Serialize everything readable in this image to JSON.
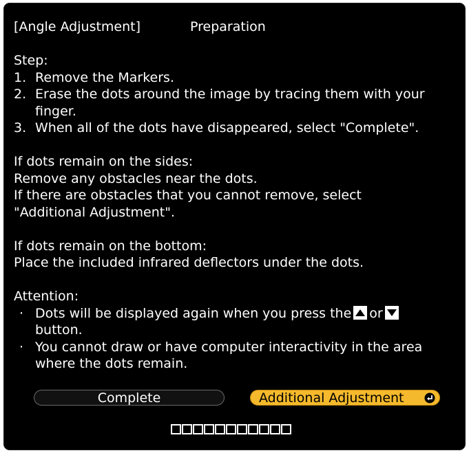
{
  "header": {
    "title": "[Angle Adjustment]",
    "subtitle": "Preparation"
  },
  "steps": {
    "heading": "Step:",
    "items": [
      {
        "num": "1.",
        "text": "Remove the Markers."
      },
      {
        "num": "2.",
        "text": "Erase the dots around the image by tracing them with your",
        "cont": "finger."
      },
      {
        "num": "3.",
        "text": "When all of the dots have disappeared, select \"Complete\"."
      }
    ]
  },
  "sides": {
    "heading": "If dots remain on the sides:",
    "line1": "Remove any obstacles near the dots.",
    "line2": "If there are obstacles that you cannot remove, select",
    "line3": "\"Additional Adjustment\"."
  },
  "bottom": {
    "heading": "If dots remain on the bottom:",
    "line1": "Place the included infrared deflectors under the dots."
  },
  "attention": {
    "heading": "Attention:",
    "bullet1_pre": "Dots will be displayed again when you press the",
    "bullet1_or": "or",
    "bullet1_cont": "button.",
    "bullet2": "You cannot draw or have computer interactivity in the area",
    "bullet2_cont": "where the dots remain.",
    "bullet_symbol": "·"
  },
  "buttons": {
    "complete": "Complete",
    "additional": "Additional Adjustment"
  },
  "icons": {
    "up": "up-arrow-key-icon",
    "down": "down-arrow-key-icon",
    "enter": "enter-icon"
  },
  "progress": {
    "total": 11,
    "filled": 0
  },
  "colors": {
    "background": "#000000",
    "text": "#ffffff",
    "selected_button": "#f4b92c"
  }
}
